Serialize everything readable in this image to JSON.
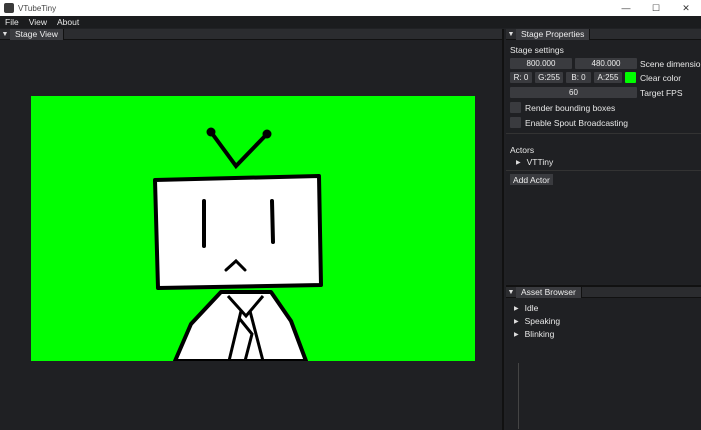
{
  "window": {
    "title": "VTubeTiny",
    "minimize": "—",
    "maximize": "☐",
    "close": "✕"
  },
  "menu": [
    "File",
    "View",
    "About"
  ],
  "stage_view": {
    "tab": "Stage View",
    "canvas_color": "#00ff00"
  },
  "stage_properties": {
    "tab": "Stage Properties",
    "settings_label": "Stage settings",
    "width": "800.000",
    "height": "480.000",
    "dimension_label": "Scene dimensio",
    "color": {
      "r": "R:  0",
      "g": "G:255",
      "b": "B:  0",
      "a": "A:255",
      "swatch": "#00ff00",
      "label": "Clear color"
    },
    "fps": "60",
    "fps_label": "Target FPS",
    "render_bounding_boxes": "Render bounding boxes",
    "spout": "Enable Spout Broadcasting",
    "actors_label": "Actors",
    "actors": [
      "VTTiny"
    ],
    "add_actor": "Add Actor"
  },
  "asset_browser": {
    "tab": "Asset Browser",
    "items": [
      "Idle",
      "Speaking",
      "Blinking"
    ]
  }
}
